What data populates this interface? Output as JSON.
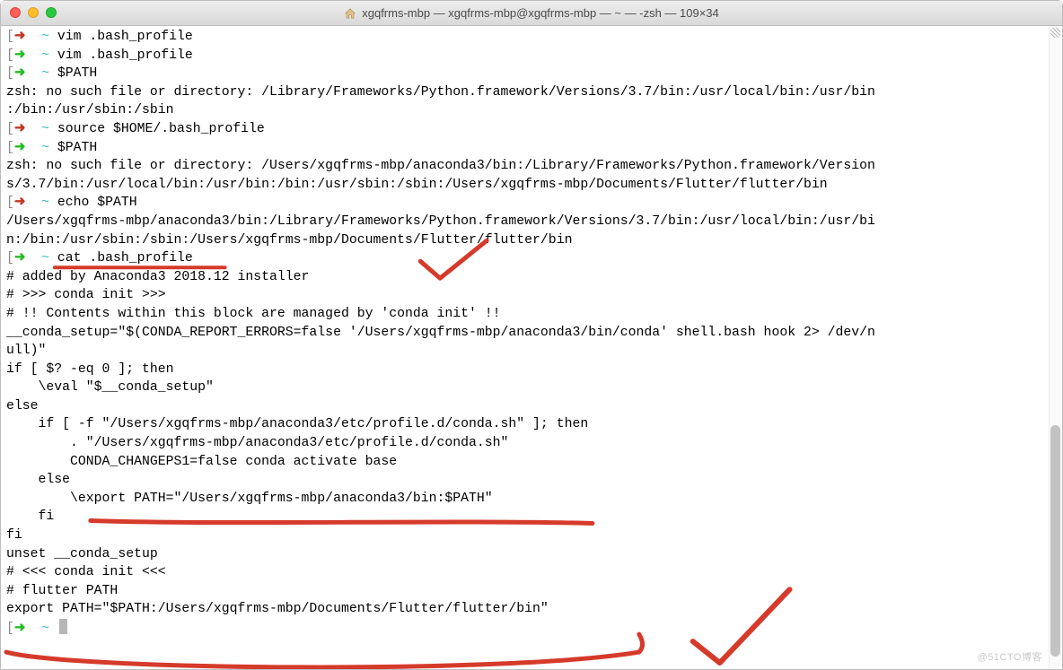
{
  "window": {
    "title": "xgqfrms-mbp — xgqfrms-mbp@xgqfrms-mbp — ~ — -zsh — 109×34"
  },
  "scrollbar": {
    "thumb_top_pct": 62,
    "thumb_height_pct": 36
  },
  "watermark": "@51CTO博客",
  "lines": [
    {
      "type": "prompt",
      "arrow": "red",
      "tilde": "~",
      "cmd": "vim .bash_profile",
      "rbracket": "]"
    },
    {
      "type": "prompt",
      "arrow": "green",
      "tilde": "~",
      "cmd": "vim .bash_profile",
      "rbracket": "]"
    },
    {
      "type": "prompt",
      "arrow": "green",
      "tilde": "~",
      "cmd": "$PATH",
      "rbracket": "]"
    },
    {
      "type": "out",
      "text": "zsh: no such file or directory: /Library/Frameworks/Python.framework/Versions/3.7/bin:/usr/local/bin:/usr/bin"
    },
    {
      "type": "out",
      "text": ":/bin:/usr/sbin:/sbin"
    },
    {
      "type": "prompt",
      "arrow": "red",
      "tilde": "~",
      "cmd": "source $HOME/.bash_profile",
      "rbracket": "]"
    },
    {
      "type": "prompt",
      "arrow": "green",
      "tilde": "~",
      "cmd": "$PATH",
      "rbracket": "]"
    },
    {
      "type": "out",
      "text": "zsh: no such file or directory: /Users/xgqfrms-mbp/anaconda3/bin:/Library/Frameworks/Python.framework/Version"
    },
    {
      "type": "out",
      "text": "s/3.7/bin:/usr/local/bin:/usr/bin:/bin:/usr/sbin:/sbin:/Users/xgqfrms-mbp/Documents/Flutter/flutter/bin"
    },
    {
      "type": "prompt",
      "arrow": "red",
      "tilde": "~",
      "cmd": "echo $PATH",
      "rbracket": "]"
    },
    {
      "type": "out",
      "text": "/Users/xgqfrms-mbp/anaconda3/bin:/Library/Frameworks/Python.framework/Versions/3.7/bin:/usr/local/bin:/usr/bi"
    },
    {
      "type": "out",
      "text": "n:/bin:/usr/sbin:/sbin:/Users/xgqfrms-mbp/Documents/Flutter/flutter/bin"
    },
    {
      "type": "prompt",
      "arrow": "green",
      "tilde": "~",
      "cmd": "cat .bash_profile",
      "rbracket": "]"
    },
    {
      "type": "out",
      "text": "# added by Anaconda3 2018.12 installer"
    },
    {
      "type": "out",
      "text": "# >>> conda init >>>"
    },
    {
      "type": "out",
      "text": "# !! Contents within this block are managed by 'conda init' !!"
    },
    {
      "type": "out",
      "text": "__conda_setup=\"$(CONDA_REPORT_ERRORS=false '/Users/xgqfrms-mbp/anaconda3/bin/conda' shell.bash hook 2> /dev/n"
    },
    {
      "type": "out",
      "text": "ull)\""
    },
    {
      "type": "out",
      "text": "if [ $? -eq 0 ]; then"
    },
    {
      "type": "out",
      "text": "    \\eval \"$__conda_setup\""
    },
    {
      "type": "out",
      "text": "else"
    },
    {
      "type": "out",
      "text": "    if [ -f \"/Users/xgqfrms-mbp/anaconda3/etc/profile.d/conda.sh\" ]; then"
    },
    {
      "type": "out",
      "text": "        . \"/Users/xgqfrms-mbp/anaconda3/etc/profile.d/conda.sh\""
    },
    {
      "type": "out",
      "text": "        CONDA_CHANGEPS1=false conda activate base"
    },
    {
      "type": "out",
      "text": "    else"
    },
    {
      "type": "out",
      "text": "        \\export PATH=\"/Users/xgqfrms-mbp/anaconda3/bin:$PATH\""
    },
    {
      "type": "out",
      "text": "    fi"
    },
    {
      "type": "out",
      "text": "fi"
    },
    {
      "type": "out",
      "text": "unset __conda_setup"
    },
    {
      "type": "out",
      "text": "# <<< conda init <<<"
    },
    {
      "type": "out",
      "text": ""
    },
    {
      "type": "out",
      "text": "# flutter PATH"
    },
    {
      "type": "out",
      "text": "export PATH=\"$PATH:/Users/xgqfrms-mbp/Documents/Flutter/flutter/bin\""
    },
    {
      "type": "prompt",
      "arrow": "green",
      "tilde": "~",
      "cmd": "",
      "cursor": true
    }
  ]
}
